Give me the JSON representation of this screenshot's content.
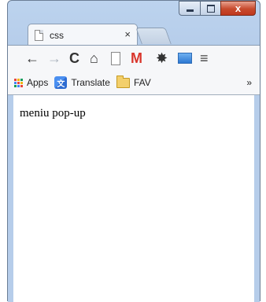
{
  "tab": {
    "title": "css",
    "close": "×"
  },
  "caption": {
    "close": "x"
  },
  "toolbar": {
    "back": "←",
    "forward": "→",
    "reload": "C",
    "home": "⌂",
    "gmail": "M",
    "settings": "✸",
    "menu": "≡",
    "icons": [
      "arrow-left-icon",
      "arrow-right-icon",
      "reload-icon",
      "home-icon",
      "page-icon",
      "gmail-icon",
      "gear-icon",
      "screen-icon",
      "menu-icon"
    ]
  },
  "bookmarks": {
    "apps": "Apps",
    "translate": "Translate",
    "fav": "FAV",
    "more": "»"
  },
  "page": {
    "text": "meniu pop-up"
  },
  "colors": {
    "close_red": "#c74a2d",
    "gmail_red": "#d9352b",
    "frame_blue": "#b6cdea"
  }
}
